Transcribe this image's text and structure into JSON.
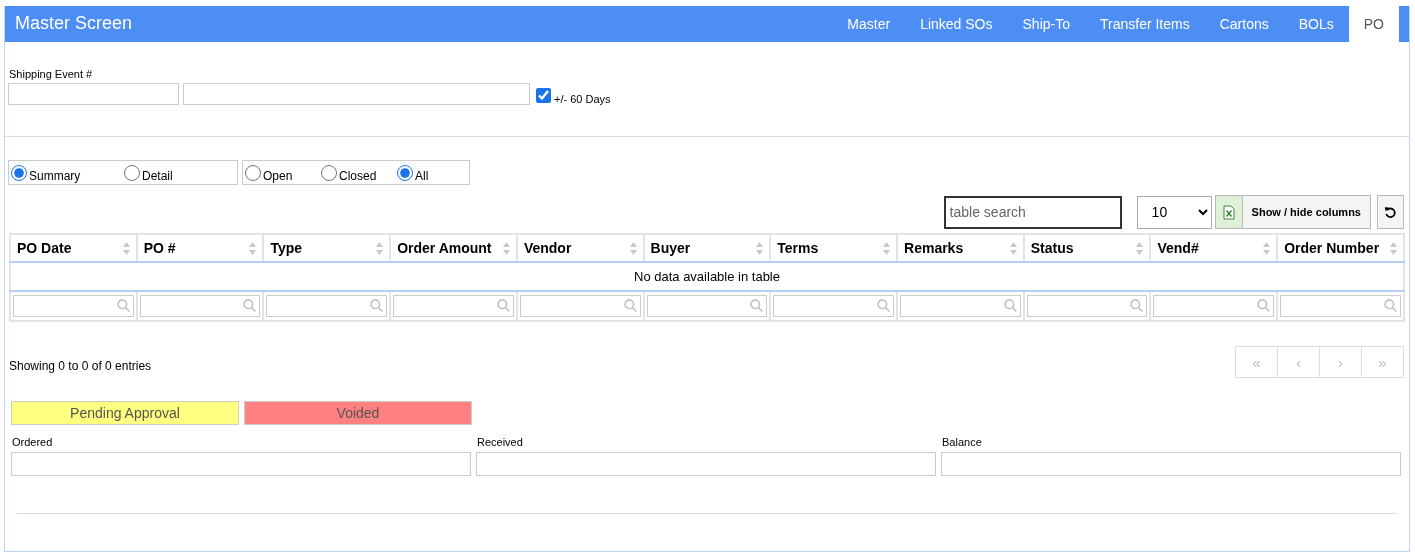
{
  "header": {
    "title": "Master Screen",
    "tabs": [
      {
        "label": "Master",
        "selected": false
      },
      {
        "label": "Linked SOs",
        "selected": false
      },
      {
        "label": "Ship-To",
        "selected": false
      },
      {
        "label": "Transfer Items",
        "selected": false
      },
      {
        "label": "Cartons",
        "selected": false
      },
      {
        "label": "BOLs",
        "selected": false
      },
      {
        "label": "PO",
        "selected": true
      }
    ]
  },
  "shipping_event": {
    "label": "Shipping Event #",
    "range_checkbox": {
      "label": "+/- 60 Days",
      "checked": true
    }
  },
  "view_options": [
    {
      "label": "Summary",
      "selected": true
    },
    {
      "label": "Detail",
      "selected": false
    }
  ],
  "status_options": [
    {
      "label": "Open",
      "selected": false
    },
    {
      "label": "Closed",
      "selected": false
    },
    {
      "label": "All",
      "selected": true
    }
  ],
  "toolbar": {
    "search_placeholder": "table search",
    "page_size": "10",
    "columns_button": "Show / hide columns"
  },
  "table": {
    "columns": [
      "PO Date",
      "PO #",
      "Type",
      "Order Amount",
      "Vendor",
      "Buyer",
      "Terms",
      "Remarks",
      "Status",
      "Vend#",
      "Order Number"
    ],
    "empty_message": "No data available in table"
  },
  "info": "Showing 0 to 0 of 0 entries",
  "pager": [
    {
      "label": "«",
      "disabled": true
    },
    {
      "label": "‹",
      "disabled": true
    },
    {
      "label": "›",
      "disabled": true
    },
    {
      "label": "»",
      "disabled": true
    }
  ],
  "legend": [
    {
      "label": "Pending Approval",
      "color": "#ffff80"
    },
    {
      "label": "Voided",
      "color": "#ff8080"
    }
  ],
  "totals": [
    "Ordered",
    "Received",
    "Balance"
  ]
}
